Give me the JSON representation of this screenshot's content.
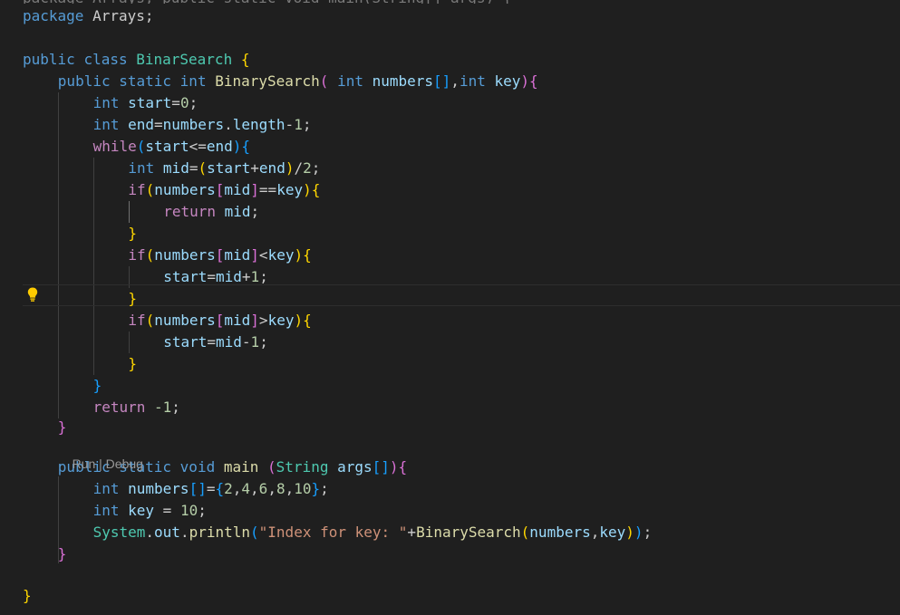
{
  "code": {
    "line_top_partial": "package Arrays; public static void main(String[] args) {",
    "l1": [
      "package ",
      "Arrays",
      ";"
    ],
    "l2": [
      "public ",
      "class ",
      "BinarSearch",
      " ",
      "{"
    ],
    "l3": [
      "public ",
      "static ",
      "int ",
      "BinarySearch",
      "( ",
      "int ",
      "numbers",
      "[]",
      ",",
      "int ",
      "key",
      ")",
      "{"
    ],
    "l4": [
      "int ",
      "start",
      "=",
      "0",
      ";"
    ],
    "l5": [
      "int ",
      "end",
      "=",
      "numbers",
      ".",
      "length",
      "-",
      "1",
      ";"
    ],
    "l6": [
      "while",
      "(",
      "start",
      "<=",
      "end",
      ")",
      "{"
    ],
    "l7": [
      "int ",
      "mid",
      "=",
      "(",
      "start",
      "+",
      "end",
      ")",
      "/",
      "2",
      ";"
    ],
    "l8": [
      "if",
      "(",
      "numbers",
      "[",
      "mid",
      "]",
      "==",
      "key",
      ")",
      "{"
    ],
    "l9": [
      "return ",
      "mid",
      ";"
    ],
    "l10": [
      "}"
    ],
    "l11": [
      "if",
      "(",
      "numbers",
      "[",
      "mid",
      "]",
      "<",
      "key",
      ")",
      "{"
    ],
    "l12": [
      "start",
      "=",
      "mid",
      "+",
      "1",
      ";"
    ],
    "l13": [
      "}"
    ],
    "l14": [
      "if",
      "(",
      "numbers",
      "[",
      "mid",
      "]",
      ">",
      "key",
      ")",
      "{"
    ],
    "l15": [
      "start",
      "=",
      "mid",
      "-",
      "1",
      ";"
    ],
    "l16": [
      "}"
    ],
    "l17": [
      "}"
    ],
    "l18": [
      "return ",
      "-1",
      ";"
    ],
    "l19": [
      "}"
    ],
    "l20": [
      "public ",
      "static ",
      "void ",
      "main",
      " ",
      "(",
      "String ",
      "args",
      "[]",
      ")",
      "{"
    ],
    "l21": [
      "int ",
      "numbers",
      "[]",
      "=",
      "{",
      "2",
      ",",
      "4",
      ",",
      "6",
      ",",
      "8",
      ",",
      "10",
      "}",
      ";"
    ],
    "l22": [
      "int ",
      "key",
      " = ",
      "10",
      ";"
    ],
    "l23": [
      "System",
      ".",
      "out",
      ".",
      "println",
      "(",
      "\"Index for key: \"",
      "+",
      "BinarySearch",
      "(",
      "numbers",
      ",",
      "key",
      ")",
      ")",
      ";"
    ],
    "l24": [
      "}"
    ],
    "l25": [
      "}"
    ]
  },
  "codelens": {
    "run": "Run",
    "separator": " | ",
    "debug": "Debug"
  },
  "icons": {
    "lightbulb": "lightbulb-icon"
  },
  "colors": {
    "background": "#1f1f1f",
    "keyword_control": "#c586c0",
    "keyword": "#569cd6",
    "variable": "#9cdcfe",
    "class": "#4ec9b0",
    "function": "#dcdcaa",
    "number": "#b5cea8",
    "string": "#ce9178",
    "bracket_1": "#ffd700",
    "bracket_2": "#da70d6",
    "bracket_3": "#179fff",
    "lightbulb": "#ffcc00"
  }
}
